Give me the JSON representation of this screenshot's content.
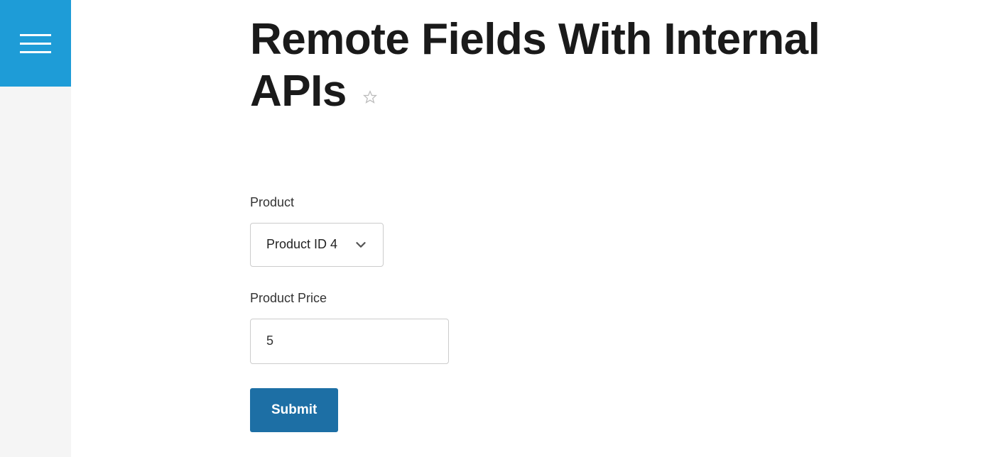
{
  "page": {
    "title": "Remote Fields With Internal APIs"
  },
  "form": {
    "product_label": "Product",
    "product_selected": "Product ID 4",
    "price_label": "Product Price",
    "price_value": "5",
    "submit_label": "Submit"
  }
}
